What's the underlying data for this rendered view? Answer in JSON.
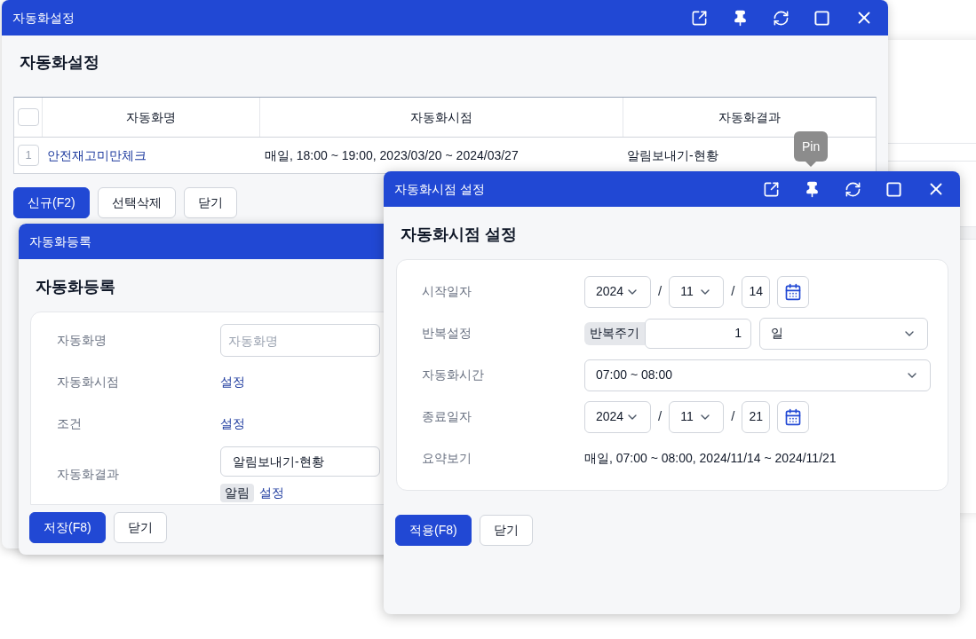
{
  "main_window": {
    "title": "자동화설정",
    "heading": "자동화설정",
    "header_checked": false,
    "columns": [
      "자동화명",
      "자동화시점",
      "자동화결과"
    ],
    "rows": [
      {
        "index": "1",
        "name": "안전재고미만체크",
        "schedule": "매일, 18:00 ~ 19:00, 2023/03/20 ~ 2024/03/27",
        "result": "알림보내기-현황",
        "checked": false
      }
    ],
    "buttons": [
      {
        "label": "신규(F2)",
        "kind": "primary"
      },
      {
        "label": "선택삭제",
        "kind": "plain"
      },
      {
        "label": "닫기",
        "kind": "plain"
      }
    ]
  },
  "tooltip": "Pin",
  "register_window": {
    "title": "자동화등록",
    "heading": "자동화등록",
    "fields": [
      {
        "label": "자동화명",
        "kind": "input",
        "placeholder": "자동화명"
      },
      {
        "label": "자동화시점",
        "kind": "link",
        "value": "설정"
      },
      {
        "label": "조건",
        "kind": "link",
        "value": "설정"
      },
      {
        "label": "자동화결과",
        "kind": "result",
        "value": "알림보내기-현황",
        "tag": "알림",
        "link": "설정"
      }
    ],
    "buttons": [
      {
        "label": "저장(F8)",
        "kind": "primary"
      },
      {
        "label": "닫기",
        "kind": "plain"
      }
    ]
  },
  "schedule_window": {
    "title": "자동화시점 설정",
    "heading": "자동화시점 설정",
    "rows": [
      {
        "label": "시작일자",
        "kind": "date",
        "year": "2024",
        "month": "11",
        "day": "14",
        "separator": "/"
      },
      {
        "label": "반복설정",
        "kind": "repeat",
        "tag": "반복주기",
        "count": "1",
        "unit": "일"
      },
      {
        "label": "자동화시간",
        "kind": "select",
        "value": "07:00 ~ 08:00"
      },
      {
        "label": "종료일자",
        "kind": "date",
        "year": "2024",
        "month": "11",
        "day": "21",
        "separator": "/"
      },
      {
        "label": "요약보기",
        "kind": "text",
        "value": "매일, 07:00 ~ 08:00, 2024/11/14 ~ 2024/11/21"
      }
    ],
    "buttons": [
      {
        "label": "적용(F8)",
        "kind": "primary"
      },
      {
        "label": "닫기",
        "kind": "plain"
      }
    ]
  }
}
